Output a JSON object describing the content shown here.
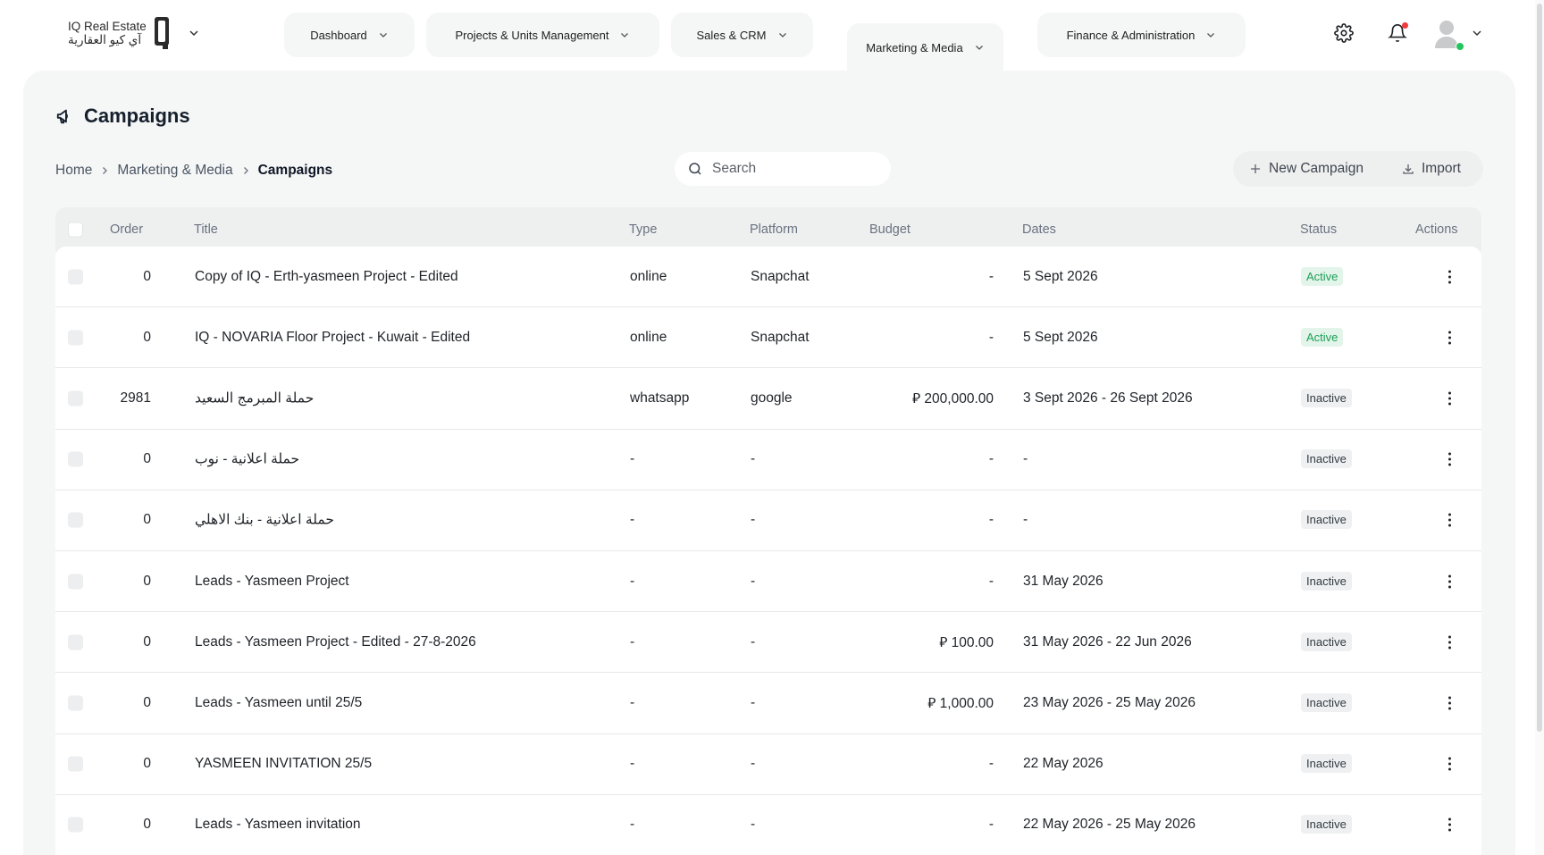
{
  "brand": {
    "name_en": "IQ Real Estate",
    "name_ar": "آي كيو العقارية"
  },
  "nav": [
    {
      "label": "Dashboard"
    },
    {
      "label": "Projects & Units Management"
    },
    {
      "label": "Sales & CRM"
    },
    {
      "label": "Marketing & Media",
      "active": true
    },
    {
      "label": "Finance & Administration"
    }
  ],
  "header_icons": [
    "gear-icon",
    "bell-icon",
    "avatar",
    "chevron-down-icon"
  ],
  "page": {
    "title": "Campaigns",
    "title_icon": "megaphone-icon"
  },
  "breadcrumb": [
    "Home",
    "Marketing & Media",
    "Campaigns"
  ],
  "search": {
    "placeholder": "Search"
  },
  "toolbar": {
    "new_label": "New Campaign",
    "import_label": "Import"
  },
  "table": {
    "columns": [
      "Order",
      "Title",
      "Type",
      "Platform",
      "Budget",
      "Dates",
      "Status",
      "Actions"
    ],
    "rows": [
      {
        "order": "0",
        "title": "Copy of IQ - Erth-yasmeen Project - Edited",
        "type": "online",
        "platform": "Snapchat",
        "budget": "-",
        "dates": "5 Sept 2026",
        "status": "Active"
      },
      {
        "order": "0",
        "title": "IQ - NOVARIA Floor Project - Kuwait - Edited",
        "type": "online",
        "platform": "Snapchat",
        "budget": "-",
        "dates": "5 Sept 2026",
        "status": "Active"
      },
      {
        "order": "2981",
        "title": "حملة المبرمج السعيد",
        "type": "whatsapp",
        "platform": "google",
        "budget": "⃁ 200,000.00",
        "dates": "3 Sept 2026 - 26 Sept 2026",
        "status": "Inactive"
      },
      {
        "order": "0",
        "title": "حملة اعلانية - نوب",
        "type": "-",
        "platform": "-",
        "budget": "-",
        "dates": "-",
        "status": "Inactive"
      },
      {
        "order": "0",
        "title": "حملة اعلانية - بنك الاهلي",
        "type": "-",
        "platform": "-",
        "budget": "-",
        "dates": "-",
        "status": "Inactive"
      },
      {
        "order": "0",
        "title": "Leads - Yasmeen Project",
        "type": "-",
        "platform": "-",
        "budget": "-",
        "dates": "31 May 2026",
        "status": "Inactive"
      },
      {
        "order": "0",
        "title": "Leads - Yasmeen Project - Edited - 27-8-2026",
        "type": "-",
        "platform": "-",
        "budget": "⃁ 100.00",
        "dates": "31 May 2026 - 22 Jun 2026",
        "status": "Inactive"
      },
      {
        "order": "0",
        "title": "Leads - Yasmeen until 25/5",
        "type": "-",
        "platform": "-",
        "budget": "⃁ 1,000.00",
        "dates": "23 May 2026 - 25 May 2026",
        "status": "Inactive"
      },
      {
        "order": "0",
        "title": "YASMEEN INVITATION 25/5",
        "type": "-",
        "platform": "-",
        "budget": "-",
        "dates": "22 May 2026",
        "status": "Inactive"
      },
      {
        "order": "0",
        "title": "Leads - Yasmeen invitation",
        "type": "-",
        "platform": "-",
        "budget": "-",
        "dates": "22 May 2026 - 25 May 2026",
        "status": "Inactive"
      }
    ]
  },
  "colors": {
    "panel_bg": "#f5f6f6",
    "active_badge_bg": "#e3f5ea",
    "active_badge_text": "#1e9e57",
    "inactive_badge_bg": "#eef0f1",
    "notification_dot": "#ef3b3b",
    "online_dot": "#22c55e"
  }
}
